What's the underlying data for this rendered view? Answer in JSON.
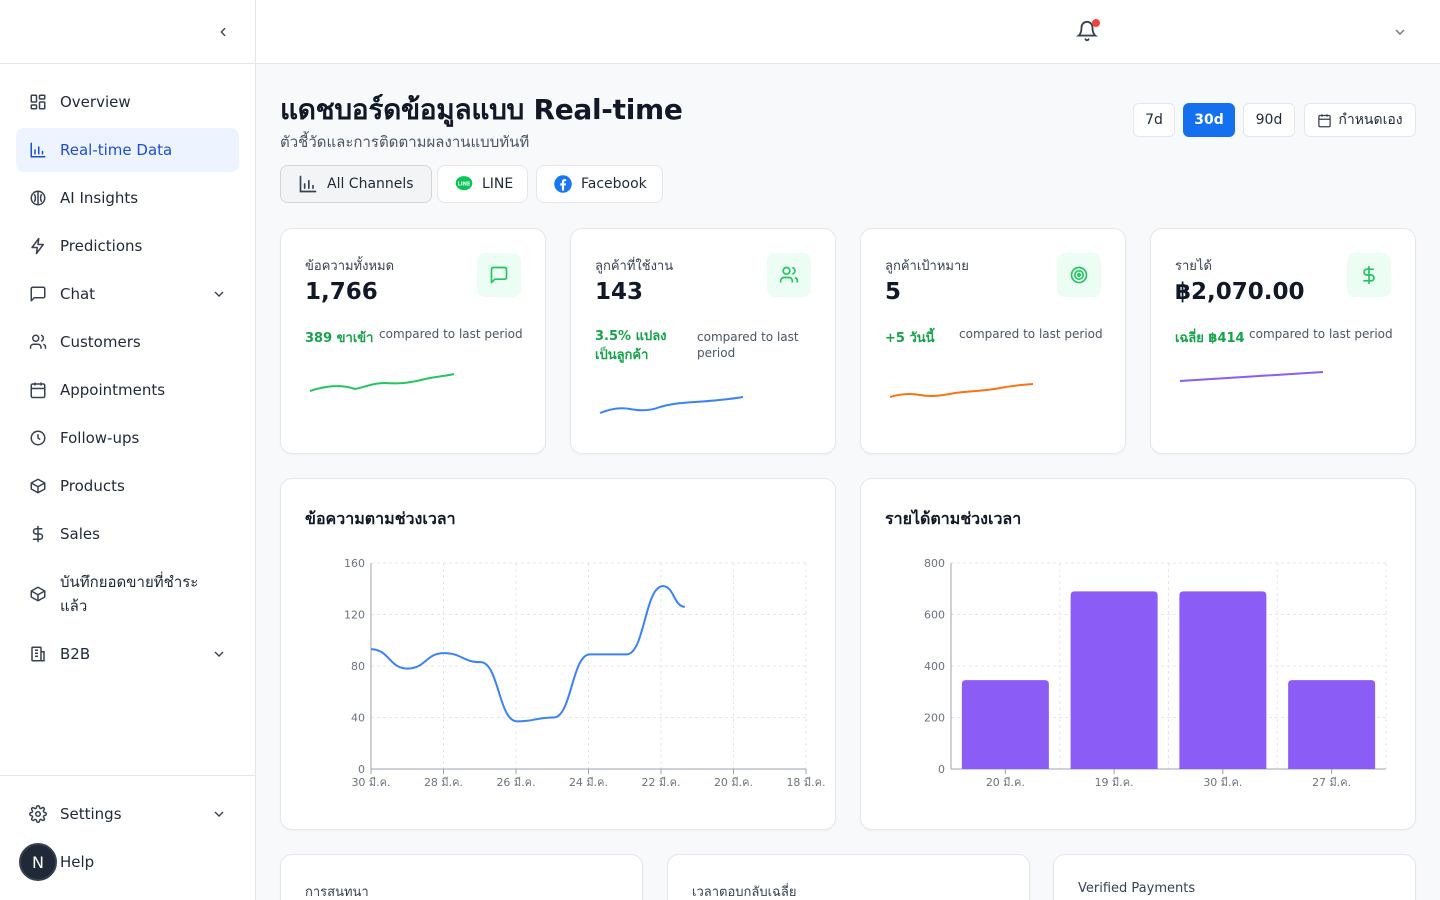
{
  "sidebar": {
    "items": [
      {
        "label": "Overview",
        "icon": "layout-grid-icon"
      },
      {
        "label": "Real-time Data",
        "icon": "bar-chart-icon",
        "active": true
      },
      {
        "label": "AI Insights",
        "icon": "brain-icon"
      },
      {
        "label": "Predictions",
        "icon": "zap-icon"
      },
      {
        "label": "Chat",
        "icon": "message-square-icon",
        "has_children": true
      },
      {
        "label": "Customers",
        "icon": "users-icon"
      },
      {
        "label": "Appointments",
        "icon": "calendar-icon"
      },
      {
        "label": "Follow-ups",
        "icon": "clock-icon"
      },
      {
        "label": "Products",
        "icon": "package-icon"
      },
      {
        "label": "Sales",
        "icon": "dollar-icon"
      },
      {
        "label": "บันทึกยอดขายที่ชำระแล้ว",
        "icon": "package-icon"
      },
      {
        "label": "B2B",
        "icon": "building-icon",
        "has_children": true
      }
    ],
    "bottom": [
      {
        "label": "Settings",
        "icon": "gear-icon",
        "has_children": true
      },
      {
        "label": "Help",
        "icon": "help-icon"
      }
    ],
    "avatar_initial": "N"
  },
  "header": {
    "title": "แดชบอร์ดข้อมูลแบบ Real-time",
    "subtitle": "ตัวชี้วัดและการติดตามผลงานแบบทันที"
  },
  "ranges": [
    {
      "label": "7d"
    },
    {
      "label": "30d",
      "active": true
    },
    {
      "label": "90d"
    },
    {
      "label": "กำหนดเอง"
    }
  ],
  "channels": [
    {
      "label": "All Channels",
      "active": true
    },
    {
      "label": "LINE"
    },
    {
      "label": "Facebook"
    }
  ],
  "colors": {
    "accent": "#1570ef",
    "green": "#22c55e",
    "blue": "#3b82f6",
    "orange": "#f97316",
    "purple": "#8b5cf6"
  },
  "stats": [
    {
      "label": "ข้อความทั้งหมด",
      "value": "1,766",
      "change": "389 ขาเข้า",
      "compare": "compared to last period",
      "icon": "message-square-icon",
      "color": "#22c55e"
    },
    {
      "label": "ลูกค้าที่ใช้งาน",
      "value": "143",
      "change": "3.5% แปลงเป็นลูกค้า",
      "compare": "compared to last period",
      "icon": "users-icon",
      "color": "#22c55e"
    },
    {
      "label": "ลูกค้าเป้าหมาย",
      "value": "5",
      "change": "+5 วันนี้",
      "compare": "compared to last period",
      "icon": "target-icon",
      "color": "#22c55e"
    },
    {
      "label": "รายได้",
      "value": "฿2,070.00",
      "change": "เฉลี่ย ฿414",
      "compare": "compared to last period",
      "icon": "dollar-icon",
      "color": "#22c55e"
    }
  ],
  "chart_data": [
    {
      "type": "line",
      "title": "ข้อความตามช่วงเวลา",
      "x_ticks": [
        "30 มี.ค.",
        "28 มี.ค.",
        "26 มี.ค.",
        "24 มี.ค.",
        "22 มี.ค.",
        "20 มี.ค.",
        "18 มี.ค."
      ],
      "y_ticks": [
        0,
        40,
        80,
        120,
        160
      ],
      "ylim": [
        0,
        160
      ],
      "x": [
        0,
        1,
        2,
        3,
        4,
        5,
        6,
        7,
        8,
        9,
        10,
        11,
        12
      ],
      "xlim": [
        0,
        19
      ],
      "values": [
        93,
        78,
        90,
        83,
        37,
        40,
        89,
        89,
        142,
        126
      ],
      "x_values": [
        0,
        1,
        2,
        3,
        4,
        5,
        6,
        7,
        8,
        8.6
      ],
      "series": [
        {
          "color": "#3b82f6"
        }
      ],
      "grid": true
    },
    {
      "type": "bar",
      "title": "รายได้ตามช่วงเวลา",
      "categories": [
        "20 มี.ค.",
        "19 มี.ค.",
        "30 มี.ค.",
        "27 มี.ค."
      ],
      "values": [
        345,
        690,
        690,
        345
      ],
      "y_ticks": [
        0,
        200,
        400,
        600,
        800
      ],
      "ylim": [
        0,
        800
      ],
      "series": [
        {
          "color": "#8b5cf6"
        }
      ],
      "grid": true
    }
  ],
  "bottom_cards": [
    {
      "label": "การสนทนา"
    },
    {
      "label": "เวลาตอบกลับเฉลี่ย"
    },
    {
      "label": "Verified Payments"
    }
  ]
}
